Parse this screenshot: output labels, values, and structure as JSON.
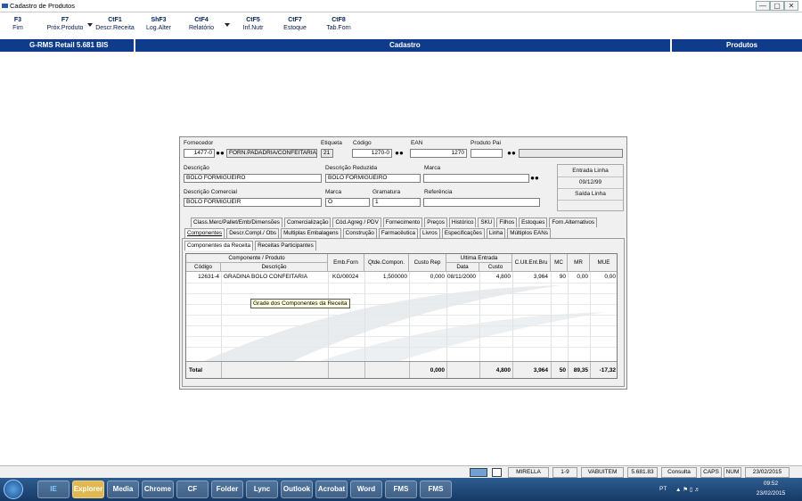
{
  "window": {
    "title": "Cadastro de Produtos",
    "controls": [
      "—",
      "▢",
      "✕"
    ]
  },
  "fkeys": [
    {
      "key": "F3",
      "label": "Fim"
    },
    {
      "key": "F7",
      "label": "Próx.Produto"
    },
    {
      "key": "CtF1",
      "label": "Descr.Receita"
    },
    {
      "key": "ShF3",
      "label": "Log.Alter"
    },
    {
      "key": "CtF4",
      "label": "Relatório"
    },
    {
      "key": "CtF5",
      "label": "Inf.Nutr"
    },
    {
      "key": "CtF7",
      "label": "Estoque"
    },
    {
      "key": "CtF8",
      "label": "Tab.Forn"
    }
  ],
  "header": {
    "app": "G-RMS Retail 5.681 BIS",
    "center": "Cadastro",
    "right": "Produtos"
  },
  "form": {
    "fornecedor": {
      "label": "Fornecedor",
      "code": "1477-0",
      "name": "FORN.PADADRIA/CONFEITARIA"
    },
    "etiqueta": {
      "label": "Etiqueta",
      "value": "21"
    },
    "codigo": {
      "label": "Código",
      "value": "1270-0"
    },
    "ean": {
      "label": "EAN",
      "value": "1270"
    },
    "produto_pai": {
      "label": "Produto Pai",
      "value": ""
    },
    "descricao": {
      "label": "Descrição",
      "value": "BOLO FORMIGUEIRO"
    },
    "descricao_reduzida": {
      "label": "Descrição Reduzida",
      "value": "BOLO FORMIGUEIRO"
    },
    "marca_top": {
      "label": "Marca",
      "value": ""
    },
    "descricao_comercial": {
      "label": "Descrição Comercial",
      "value": "BOLO FORMIGUEIR"
    },
    "marca": {
      "label": "Marca",
      "value": "O"
    },
    "gramatura": {
      "label": "Gramatura",
      "value": "1"
    },
    "referencia": {
      "label": "Referência",
      "value": ""
    },
    "entrada_linha": {
      "label": "Entrada Linha",
      "value": "09/12/99"
    },
    "saida_linha": {
      "label": "Saída Linha",
      "value": ""
    }
  },
  "tabs_row1": [
    "Class.Merc/Pallet/Emb/Dimensões",
    "Comercialização",
    "Cód.Agreg / PDV",
    "Fornecimento",
    "Preços",
    "Histórico",
    "SKU",
    "Filhos",
    "Estoques",
    "Forn.Alternativos"
  ],
  "tabs_row2": [
    "Componentes",
    "Descr.Compl./ Obs",
    "Multiplas Embalagens",
    "Construção",
    "Farmacêutica",
    "Livros",
    "Especificações",
    "Linha",
    "Múltiplos EANs"
  ],
  "subtabs": [
    "Componentes da Receita",
    "Receitas Participantes"
  ],
  "grid": {
    "group_headers": {
      "componente": "Componente / Produto",
      "ultima_entrada": "Ultima Entrada"
    },
    "columns": {
      "codigo": "Código",
      "descricao": "Descrição",
      "emb_forn": "Emb.Forn",
      "qtde": "Qtde.Compon.",
      "custo_rep": "Custo Rep",
      "data": "Data",
      "custo": "Custo",
      "c_ult": "C.Ult.Ent.Bru",
      "mc": "MC",
      "mr": "MR",
      "mue": "MUE"
    },
    "rows": [
      {
        "codigo": "12631-4",
        "descricao": "GRADINA BOLO CONFEITARIA",
        "emb_forn": "KG/00024",
        "qtde": "1,500000",
        "custo_rep": "0,000",
        "data": "08/11/2000",
        "custo": "4,800",
        "c_ult": "3,964",
        "mc": "90",
        "mr": "0,00",
        "mue": "0,00"
      }
    ],
    "tooltip": "Grade dos Componentes da Receita",
    "total": {
      "label": "Total",
      "custo_rep": "0,000",
      "custo": "4,800",
      "c_ult": "3,964",
      "mc": "50",
      "mr": "89,35",
      "mue": "-17,32"
    }
  },
  "statusbar": [
    "MIRELLA",
    "1-9",
    "VABUITEM",
    "5.681.83",
    "Consulta",
    "CAPS",
    "NUM",
    "23/02/2015"
  ],
  "taskbar": {
    "apps": [
      "IE",
      "Explorer",
      "Media",
      "Chrome",
      "CF",
      "Folder",
      "Lync",
      "Outlook",
      "Acrobat",
      "Word",
      "FMS",
      "FMS"
    ],
    "lang": "PT",
    "time": "09:52",
    "date": "23/02/2015"
  }
}
